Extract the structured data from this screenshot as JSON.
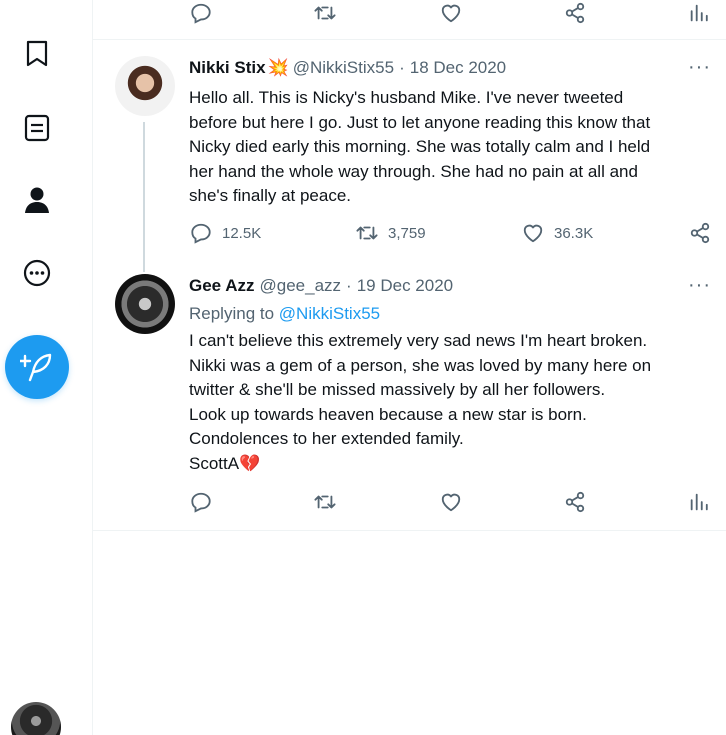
{
  "nav": {
    "items": [
      {
        "name": "bookmarks-icon"
      },
      {
        "name": "lists-icon"
      },
      {
        "name": "profile-icon"
      },
      {
        "name": "more-icon"
      }
    ],
    "compose_icon": "compose-tweet-icon"
  },
  "top_actions": {
    "reply": "reply-icon",
    "retweet": "retweet-icon",
    "like": "like-icon",
    "share": "share-icon",
    "analytics": "analytics-icon"
  },
  "tweets": [
    {
      "name": "Nikki Stix",
      "badge": "💥",
      "handle": "@NikkiStix55",
      "separator": "·",
      "date": "18 Dec 2020",
      "more": "···",
      "lines": [
        "Hello all. This is Nicky's husband Mike. I've never tweeted",
        "before but here I go. Just to let anyone reading this know that",
        "Nicky died early this morning. She was totally calm and I held",
        "her hand the whole way through. She had no pain at all and",
        "she's finally at peace."
      ],
      "replies": "12.5K",
      "retweets": "3,759",
      "likes": "36.3K"
    },
    {
      "name": "Gee Azz",
      "handle": "@gee_azz",
      "separator": "·",
      "date": "19 Dec 2020",
      "more": "···",
      "replying_prefix": "Replying to ",
      "replying_mention": "@NikkiStix55",
      "lines": [
        "I can't believe this extremely very sad news I'm heart broken.",
        "Nikki was a gem of a person, she was loved by many here on",
        "twitter & she'll be missed massively by all her followers.",
        "Look up towards heaven because a new star is born.",
        "Condolences to her extended family."
      ],
      "signature": "ScottA",
      "signature_emoji": "💔"
    }
  ],
  "colors": {
    "accent": "#1d9bf0",
    "text": "#0f1419",
    "muted": "#536471",
    "border": "#eff3f4"
  }
}
